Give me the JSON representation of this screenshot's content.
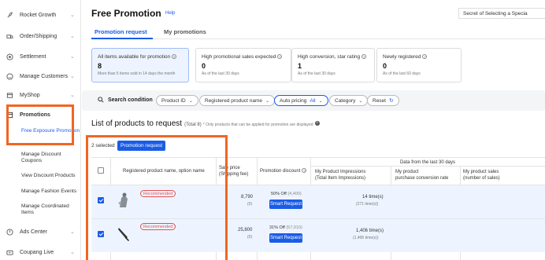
{
  "sidebar": {
    "items": [
      {
        "label": "Rocket Growth",
        "icon": "rocket-icon",
        "has_chevron": true
      },
      {
        "label": "Order/Shipping",
        "icon": "truck-icon",
        "has_chevron": true
      },
      {
        "label": "Settlement",
        "icon": "coin-icon",
        "has_chevron": true
      },
      {
        "label": "Manage Customers",
        "icon": "smiley-icon",
        "has_chevron": true
      },
      {
        "label": "MyShop",
        "icon": "shop-icon",
        "has_chevron": true
      },
      {
        "label": "Promotions",
        "icon": "promotion-icon",
        "has_chevron": false
      },
      {
        "label": "Ads Center",
        "icon": "ads-icon",
        "has_chevron": true
      },
      {
        "label": "Coupang Live",
        "icon": "live-icon",
        "has_chevron": true
      }
    ],
    "promotion_sub_items": [
      "Free Exposure Promotion",
      "Manage Discount Coupons",
      "View Discount Products",
      "Manage Fashion Events",
      "Manage Coordinated Items"
    ]
  },
  "header": {
    "title": "Free Promotion",
    "help_label": "Help",
    "secret_link": "Secret of Selecting a Specia"
  },
  "tabs": [
    {
      "label": "Promotion request",
      "active": true
    },
    {
      "label": "My promotions",
      "active": false
    }
  ],
  "stat_cards": [
    {
      "title": "All items available for promotion",
      "value": "8",
      "sub": "More than 5 items sold in 14 days the month",
      "selected": true
    },
    {
      "title": "High promotional sales expected",
      "value": "0",
      "sub": "As of the last 30 days",
      "selected": false
    },
    {
      "title": "High conversion, star rating",
      "value": "1",
      "sub": "As of the last 30 days",
      "selected": false
    },
    {
      "title": "Newly registered",
      "value": "0",
      "sub": "As of the last 60 days",
      "selected": false
    }
  ],
  "search": {
    "label": "Search condition",
    "filters": [
      {
        "label": "Product ID",
        "value": ""
      },
      {
        "label": "Registered product name",
        "value": ""
      },
      {
        "label": "Auto pricing",
        "value": "All"
      },
      {
        "label": "Category",
        "value": ""
      }
    ],
    "reset_label": "Reset"
  },
  "list": {
    "title": "List of products to request",
    "total": "(Total 8)",
    "note": "* Only products that can be applied for promotion are displayed",
    "selected_count": "2 selected",
    "promotion_request_button": "Promotion request"
  },
  "table": {
    "headers": {
      "product": "Registered product name, option name",
      "sale_price": "Sale price\n(Shipping fee)",
      "promotion_discount": "Promotion discount",
      "data_group": "Data from the last 30 days",
      "impressions": "My Product Impressions\n(Total Item Impressions)",
      "conversion": "My product\npurchase conversion rate",
      "sales": "My product sales\n(number of sales)"
    },
    "rows": [
      {
        "checked": true,
        "badge": "Recommended",
        "thumb": "gray-figure-thumbnail",
        "price": "8,790",
        "shipping": "(0)",
        "discount": "50% Off",
        "discount_orig": "(4,400)",
        "smart_request": "Smart Request",
        "impressions": "14 time(s)",
        "total_impressions": "(271 time(s))"
      },
      {
        "checked": true,
        "badge": "Recommended",
        "thumb": "knife-thumbnail",
        "price": "25,800",
        "shipping": "(0)",
        "discount": "31% Off",
        "discount_orig": "(57,910)",
        "smart_request": "Smart Request",
        "impressions": "1,406 time(s)",
        "total_impressions": "(1,406 time(s))"
      }
    ]
  },
  "colors": {
    "accent": "#1a5ce6",
    "highlight": "#f26522",
    "badge": "#e35050"
  }
}
